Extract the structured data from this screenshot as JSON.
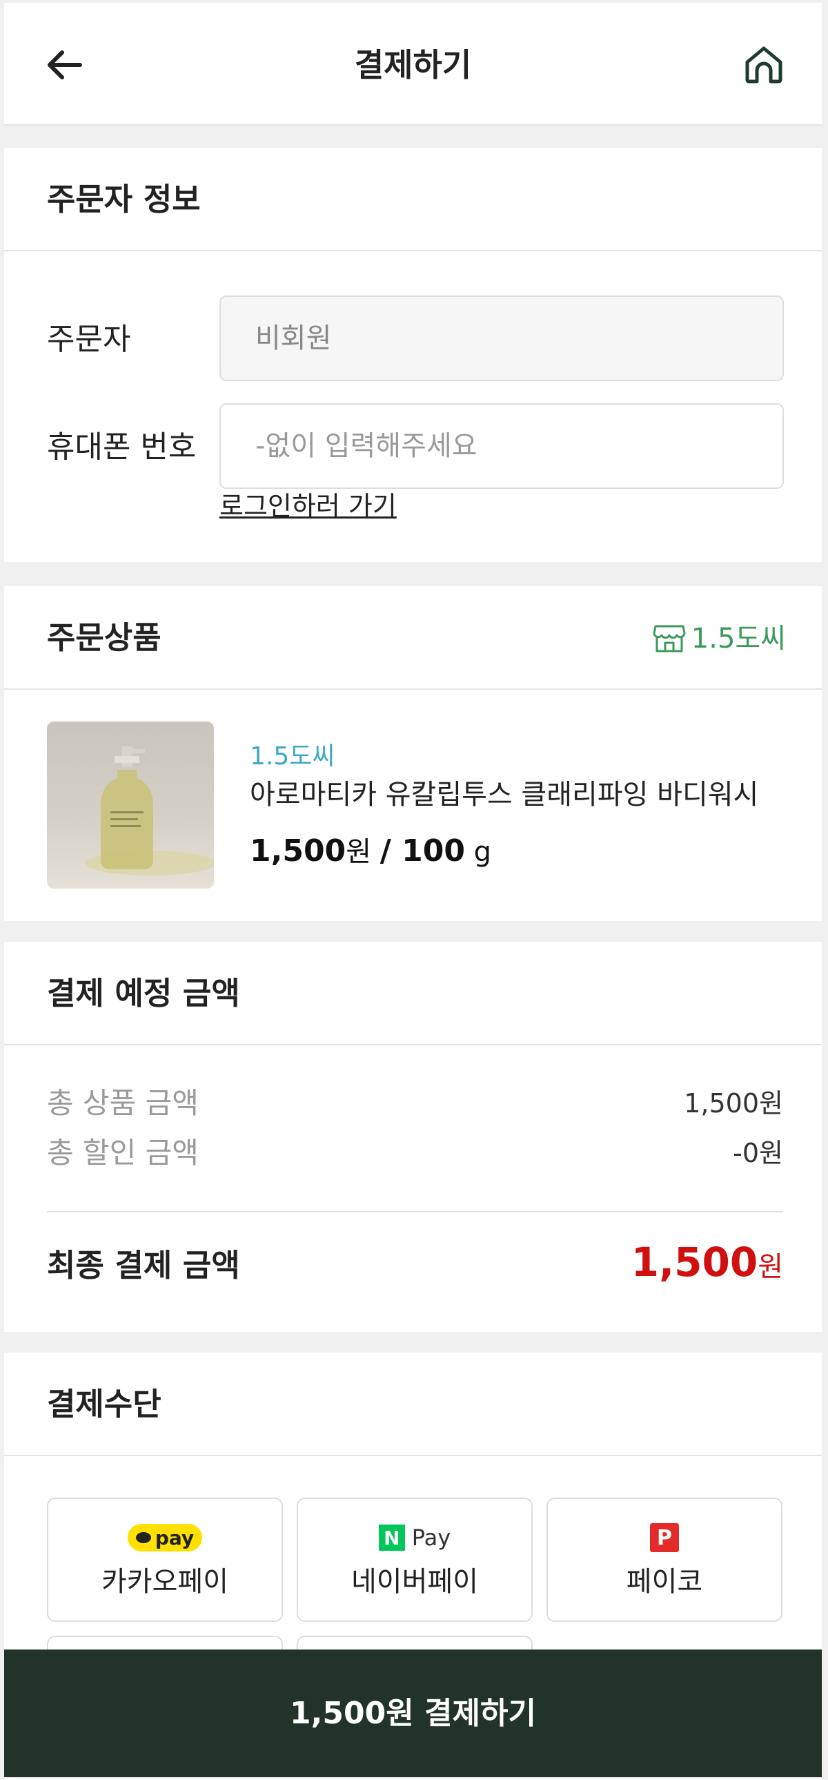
{
  "header": {
    "title": "결제하기"
  },
  "orderer": {
    "section_title": "주문자 정보",
    "name_label": "주문자",
    "name_value": "비회원",
    "phone_label": "휴대폰 번호",
    "phone_placeholder": "-없이 입력해주세요",
    "login_link": "로그인하러 가기"
  },
  "product": {
    "section_title": "주문상품",
    "store_tag": "1.5도씨",
    "store": "1.5도씨",
    "name": "아로마티카 유칼립투스 클래리파잉 바디워시",
    "price": "1,500",
    "price_unit": "원",
    "quantity": "/ 100",
    "quantity_unit": "g"
  },
  "summary": {
    "section_title": "결제 예정 금액",
    "total_label": "총 상품 금액",
    "total_value": "1,500원",
    "discount_label": "총 할인 금액",
    "discount_value": "-0원",
    "final_label": "최종 결제 금액",
    "final_value": "1,500",
    "final_unit": "원"
  },
  "payment": {
    "section_title": "결제수단",
    "methods": [
      {
        "label": "카카오페이",
        "logo_text": "pay"
      },
      {
        "label": "네이버페이",
        "logo_text": "Pay"
      },
      {
        "label": "페이코",
        "logo_text": "P"
      }
    ]
  },
  "paybar": {
    "label": "1,500원 결제하기"
  },
  "colors": {
    "accent_dark": "#22332a",
    "price_red": "#d00f0f",
    "store_green": "#3a9a5a",
    "store_blue": "#3aa8c8"
  }
}
